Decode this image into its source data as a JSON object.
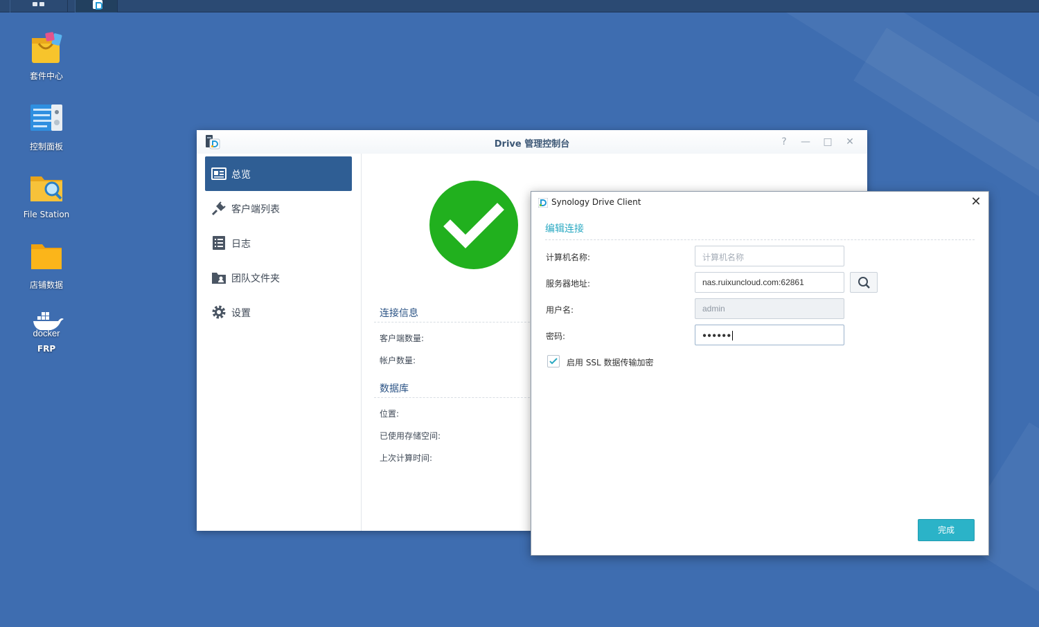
{
  "desktop": {
    "icons": [
      {
        "label": "套件中心"
      },
      {
        "label": "控制面板"
      },
      {
        "label": "File Station"
      },
      {
        "label": "店铺数据"
      },
      {
        "label": "FRP",
        "logo_text": "docker"
      }
    ]
  },
  "drive_window": {
    "title": "Drive 管理控制台",
    "controls": {
      "help": "?",
      "minimize": "—",
      "maximize": "□",
      "close": "✕"
    },
    "sidebar": [
      {
        "label": "总览",
        "active": true
      },
      {
        "label": "客户端列表"
      },
      {
        "label": "日志"
      },
      {
        "label": "团队文件夹"
      },
      {
        "label": "设置"
      }
    ],
    "connection": {
      "title": "连接信息",
      "rows": [
        "客户端数量:",
        "帐户数量:"
      ]
    },
    "database": {
      "title": "数据库",
      "rows": [
        "位置:",
        "已使用存储空间:",
        "上次计算时间:"
      ]
    }
  },
  "client_dialog": {
    "title": "Synology Drive Client",
    "heading": "编辑连接",
    "fields": [
      {
        "label": "计算机名称:",
        "value": "",
        "placeholder": "计算机名称"
      },
      {
        "label": "服务器地址:",
        "value": "nas.ruixuncloud.com:62861"
      },
      {
        "label": "用户名:",
        "value": "admin"
      },
      {
        "label": "密码:",
        "value": "●●●●●●"
      }
    ],
    "ssl_checkbox": {
      "label": "启用 SSL 数据传输加密",
      "checked": true
    },
    "done_button": "完成"
  },
  "colors": {
    "desktop_bg": "#3e6db0",
    "sidebar_active": "#2f5e94",
    "accent_teal": "#2bb3c8",
    "success_green": "#21b01e"
  }
}
